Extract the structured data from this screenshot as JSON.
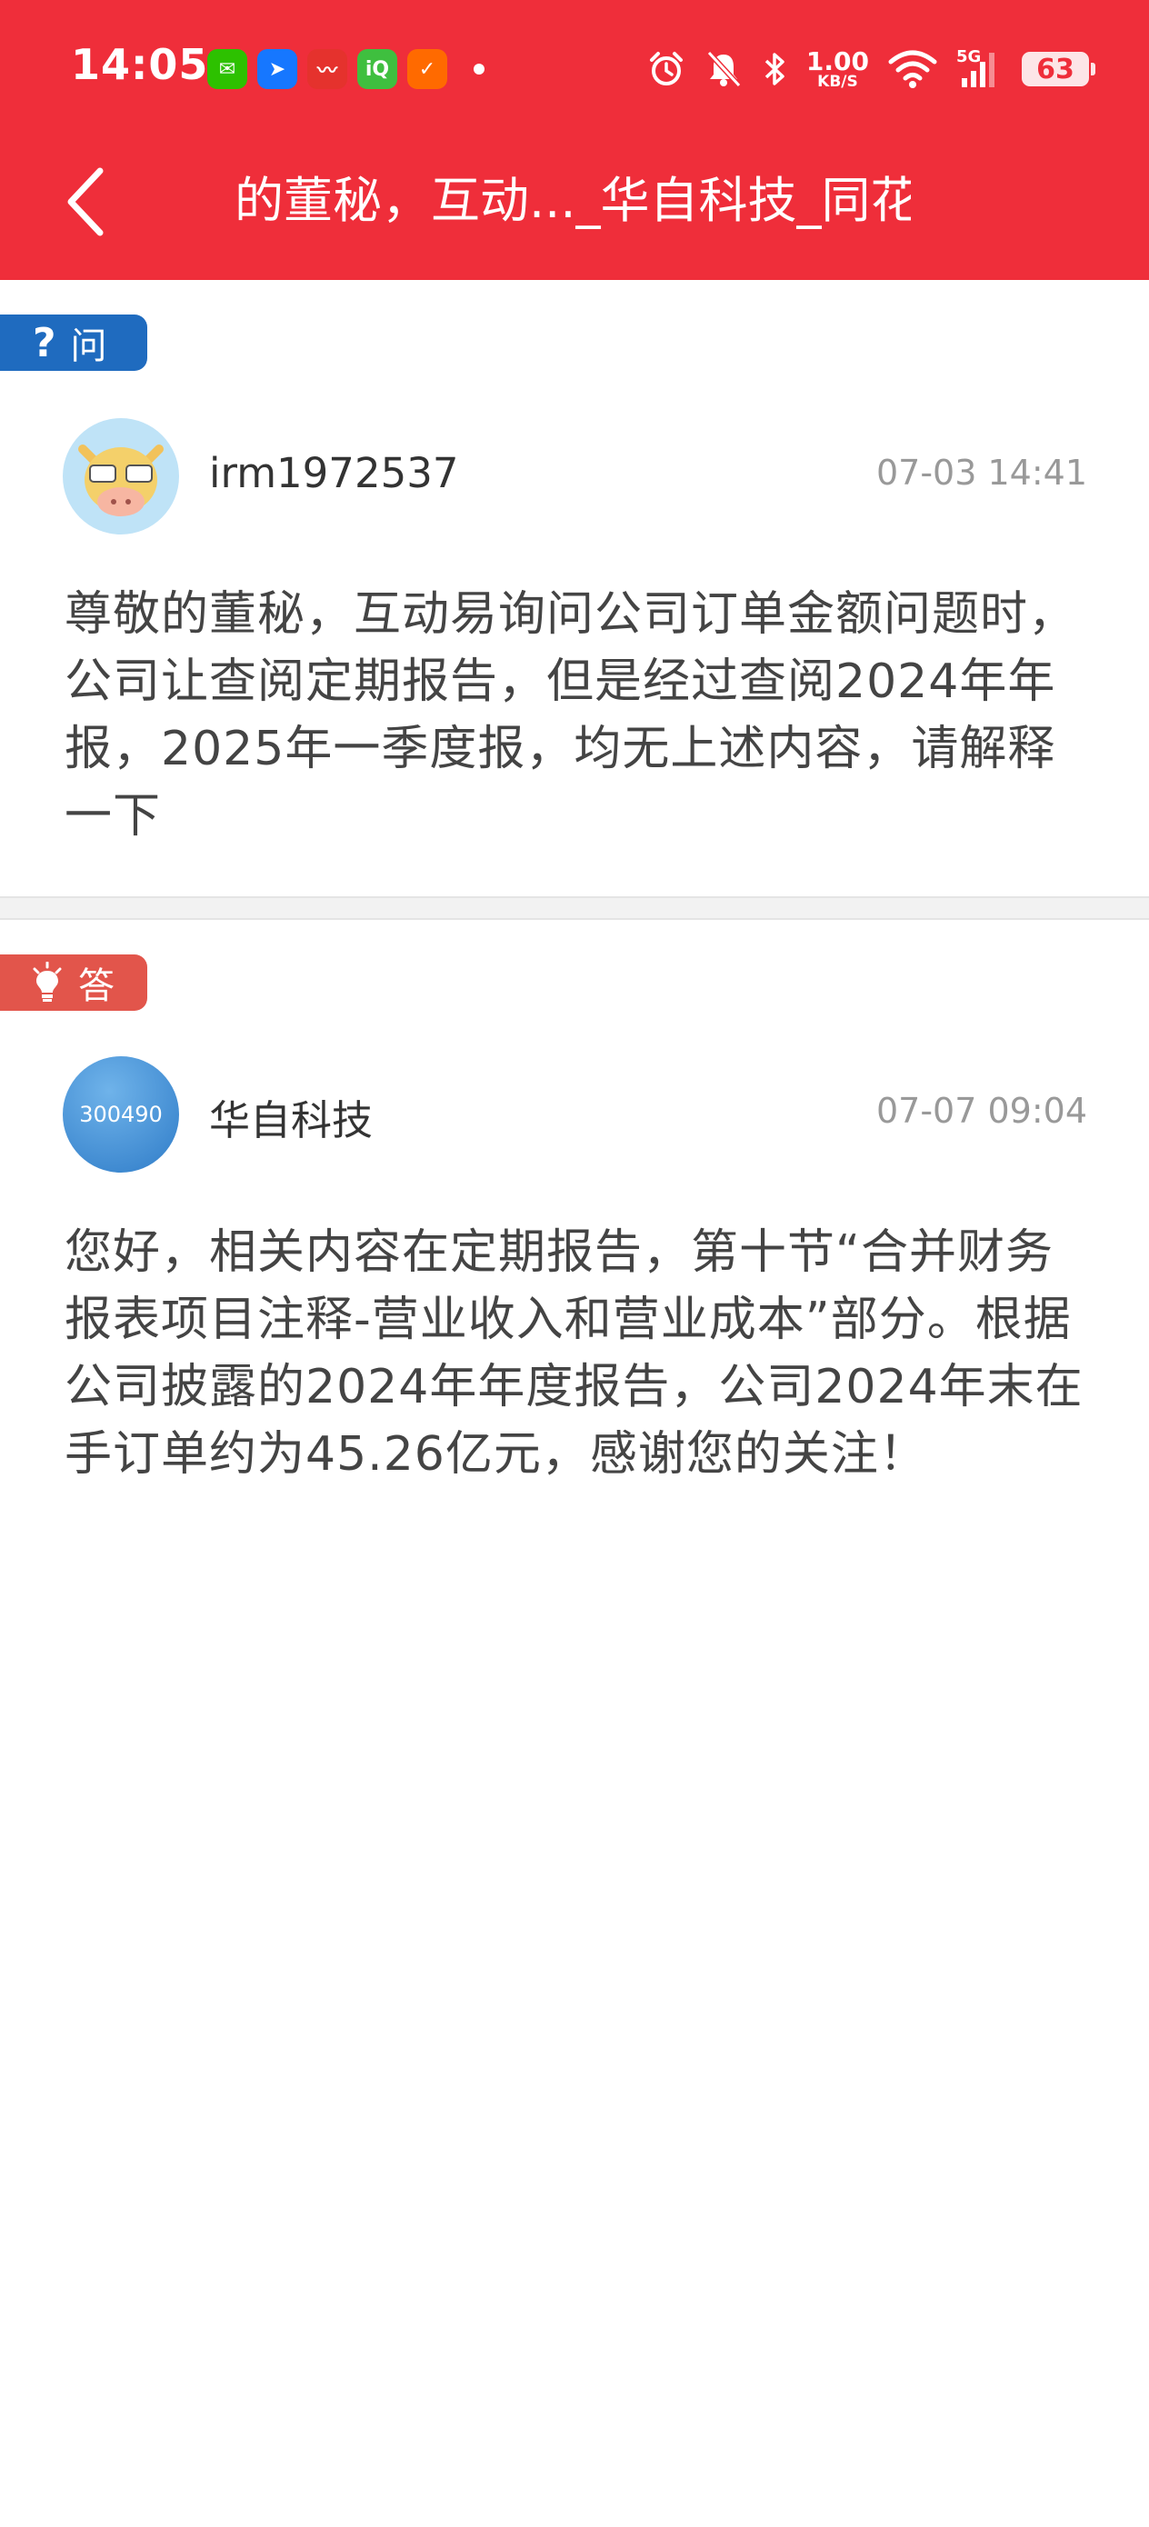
{
  "status_bar": {
    "time": "14:05",
    "app_icons": [
      {
        "name": "wechat-icon",
        "color": "#2dc100",
        "glyph": "✉"
      },
      {
        "name": "alipay-icon",
        "color": "#1677ff",
        "glyph": "➤"
      },
      {
        "name": "stock-app-icon",
        "color": "#e5322d",
        "glyph": "〰"
      },
      {
        "name": "iqiyi-icon",
        "color": "#3fbf3f",
        "glyph": "iQ"
      },
      {
        "name": "news-app-icon",
        "color": "#ff6a00",
        "glyph": "✓"
      }
    ],
    "net_speed_value": "1.00",
    "net_speed_unit": "KB/S",
    "network_type": "5G",
    "battery": "63"
  },
  "header": {
    "back_icon": "chevron-left-icon",
    "title": "的董秘，互动..._华自科技_同花顺"
  },
  "question": {
    "tag_icon": "question-icon",
    "tag_label": "问",
    "user_name": "irm1972537",
    "time": "07-03 14:41",
    "text": "尊敬的董秘，互动易询问公司订单金额问题时，公司让查阅定期报告，但是经过查阅2024年年报，2025年一季度报，均无上述内容，请解释一下"
  },
  "answer": {
    "tag_icon": "lightbulb-icon",
    "tag_label": "答",
    "avatar_code": "300490",
    "user_name": "华自科技",
    "time": "07-07 09:04",
    "text": "您好，相关内容在定期报告，第十节“合并财务报表项目注释-营业收入和营业成本”部分。根据公司披露的2024年年度报告，公司2024年末在手订单约为45.26亿元，感谢您的关注！"
  },
  "colors": {
    "brand_red": "#ef2e3a",
    "question_blue": "#1f6bbf",
    "answer_red": "#e2554b"
  }
}
